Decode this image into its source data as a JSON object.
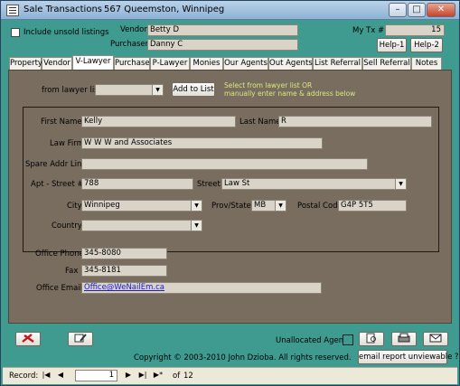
{
  "window": {
    "title": "Sale Transactions",
    "address": "567 Queemston, Winnipeg",
    "controls": {
      "minimize": "–",
      "maximize": "□",
      "close": "✕"
    }
  },
  "header": {
    "include_unsold_label": "Include unsold listings",
    "vendor_label": "Vendor",
    "vendor_value": "Betty D",
    "purchaser_label": "Purchaser",
    "purchaser_value": "Danny C",
    "mytx_label": "My Tx #",
    "mytx_value": "15",
    "help1": "Help-1",
    "help2": "Help-2"
  },
  "tabs": [
    {
      "label": "Property"
    },
    {
      "label": "Vendor"
    },
    {
      "label": "V-Lawyer"
    },
    {
      "label": "Purchaser"
    },
    {
      "label": "P-Lawyer"
    },
    {
      "label": "Monies"
    },
    {
      "label": "Our Agents"
    },
    {
      "label": "Out Agents"
    },
    {
      "label": "List Referral"
    },
    {
      "label": "Sell Referral"
    },
    {
      "label": "Notes"
    }
  ],
  "active_tab": "V-Lawyer",
  "lawyer": {
    "from_list_label": "from lawyer list",
    "from_list_value": "",
    "add_to_list": "Add to List",
    "hint_line1": "Select from lawyer list      OR",
    "hint_line2": "manually enter name & address below",
    "first_names_label": "First Names",
    "first_names_value": "Kelly",
    "last_name_label": "Last Name",
    "last_name_value": "R",
    "law_firm_label": "Law Firm",
    "law_firm_value": "W W W and Associates",
    "spare_addr_label": "Spare Addr Line",
    "spare_addr_value": "",
    "apt_label": "Apt - Street #",
    "apt_value": "788",
    "street_label": "Street",
    "street_value": "Law St",
    "city_label": "City",
    "city_value": "Winnipeg",
    "prov_label": "Prov/State",
    "prov_value": "MB",
    "postal_label": "Postal Code",
    "postal_value": "G4P 5T5",
    "country_label": "Country",
    "country_value": "",
    "office_phone_label": "Office Phone",
    "office_phone_value": "345-8080",
    "fax_label": "Fax",
    "fax_value": "345-8181",
    "office_email_label": "Office Email",
    "office_email_value": "Office@WeNailEm.ca"
  },
  "footer": {
    "unallocated_label": "Unallocated Agents",
    "copyright": "Copyright © 2003-2010 John Dzioba.  All rights reserved.",
    "email_report": "email report unviewable ?"
  },
  "record_nav": {
    "label": "Record:",
    "current": "1",
    "of_label": "of",
    "total": "12"
  },
  "colors": {
    "form_bg": "#3f9b8f",
    "panel_bg": "#796d5f",
    "hint_text": "#d9e87e",
    "field_bg": "#d9d3c8",
    "email_link": "#1a1ad8"
  }
}
